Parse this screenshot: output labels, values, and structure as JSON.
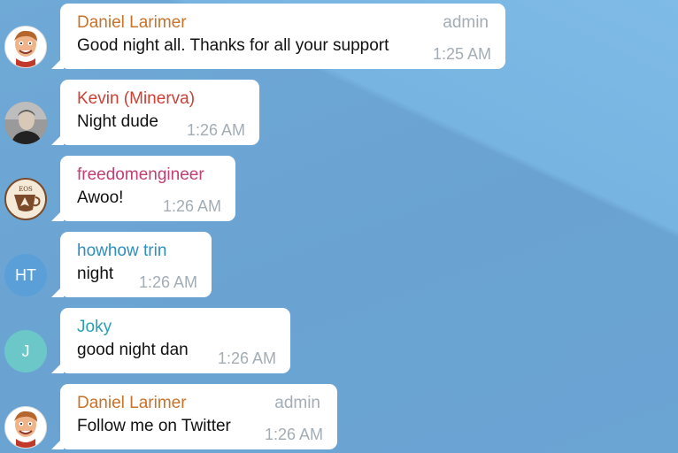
{
  "messages": [
    {
      "sender": "Daniel Larimer",
      "sender_color": "#c8722a",
      "role": "admin",
      "text": "Good night all. Thanks for all your support",
      "time": "1:25 AM",
      "avatar_type": "cartoon-face"
    },
    {
      "sender": "Kevin (Minerva)",
      "sender_color": "#cc4036",
      "role": "",
      "text": "Night dude",
      "time": "1:26 AM",
      "avatar_type": "photo"
    },
    {
      "sender": "freedomengineer",
      "sender_color": "#c13f74",
      "role": "",
      "text": "Awoo!",
      "time": "1:26 AM",
      "avatar_type": "coffee-cup-logo"
    },
    {
      "sender": "howhow trin",
      "sender_color": "#2e8ec0",
      "role": "",
      "text": "night",
      "time": "1:26 AM",
      "avatar_type": "initials",
      "avatar_initials": "HT",
      "avatar_color": "#5a9fd8"
    },
    {
      "sender": "Joky",
      "sender_color": "#2a9fb3",
      "role": "",
      "text": "good night dan",
      "time": "1:26 AM",
      "avatar_type": "initials",
      "avatar_initials": "J",
      "avatar_color": "#6cc7c9"
    },
    {
      "sender": "Daniel Larimer",
      "sender_color": "#c8722a",
      "role": "admin",
      "text": "Follow me on Twitter",
      "time": "1:26 AM",
      "avatar_type": "cartoon-face"
    }
  ]
}
